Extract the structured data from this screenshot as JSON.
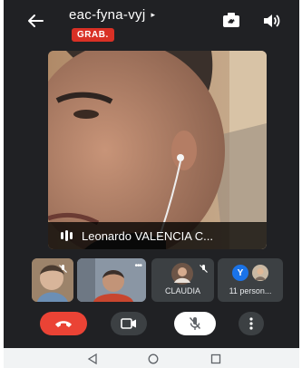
{
  "header": {
    "meeting_code": "eac-fyna-vyj",
    "caret": "▸",
    "recording_badge": "GRAB."
  },
  "main_video": {
    "participant_name": "Leonardo VALENCIA C..."
  },
  "tiles": [
    {
      "label": ""
    },
    {
      "label": ""
    },
    {
      "label": "CLAUDIA"
    },
    {
      "label": "11 person..."
    }
  ],
  "tile_4_avatar_letter": "Y",
  "more_dots": "•••",
  "colors": {
    "background": "#202124",
    "recording": "#d93025",
    "end_call": "#ea4335",
    "avatar_blue": "#1a73e8"
  },
  "icons": [
    "back-arrow-icon",
    "switch-camera-icon",
    "speaker-icon",
    "audio-level-icon",
    "mic-off-icon",
    "end-call-icon",
    "camera-icon",
    "more-vert-icon",
    "nav-back-icon",
    "nav-home-icon",
    "nav-recents-icon"
  ]
}
